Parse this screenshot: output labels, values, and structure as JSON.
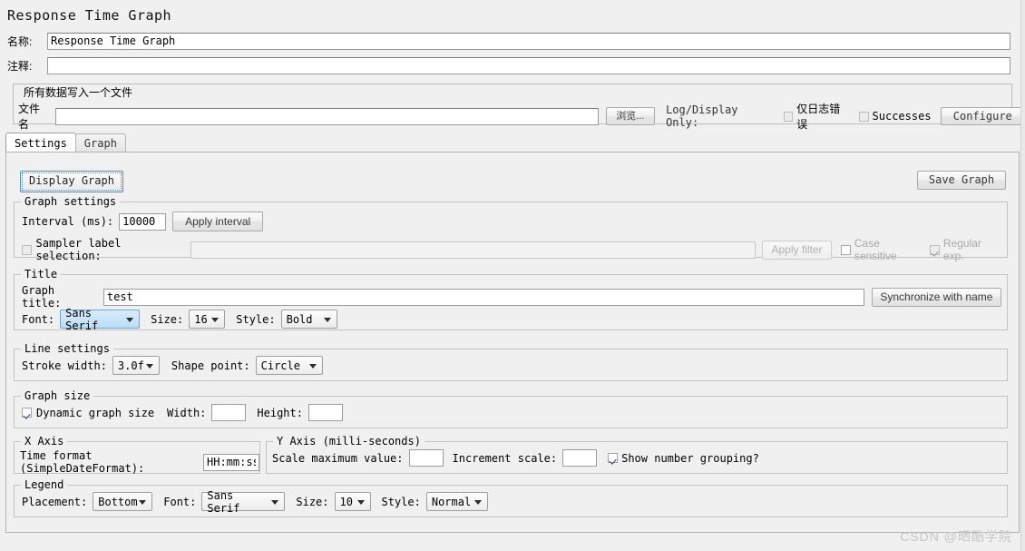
{
  "header": {
    "page_title": "Response Time Graph",
    "name_label": "名称:",
    "name_value": "Response Time Graph",
    "comment_label": "注释:",
    "comment_value": ""
  },
  "file_panel": {
    "title": "所有数据写入一个文件",
    "filename_label": "文件名",
    "filename_value": "",
    "browse_label": "浏览...",
    "log_display_label": "Log/Display Only:",
    "errors_only_label": "仅日志错误",
    "errors_only_checked": false,
    "successes_label": "Successes",
    "successes_checked": false,
    "configure_label": "Configure"
  },
  "tabs": [
    {
      "label": "Settings",
      "active": true
    },
    {
      "label": "Graph",
      "active": false
    }
  ],
  "actions": {
    "display_graph_label": "Display Graph",
    "save_graph_label": "Save Graph"
  },
  "graph_settings": {
    "group_title": "Graph settings",
    "interval_label": "Interval (ms):",
    "interval_value": "10000",
    "apply_interval_label": "Apply interval",
    "sampler_label_selection_label": "Sampler label selection:",
    "sampler_label_selection_checked": false,
    "sampler_filter_value": "",
    "apply_filter_label": "Apply filter",
    "case_sensitive_label": "Case sensitive",
    "case_sensitive_checked": false,
    "regular_exp_label": "Regular exp.",
    "regular_exp_checked": true
  },
  "title_section": {
    "group_title": "Title",
    "graph_title_label": "Graph title:",
    "graph_title_value": "test",
    "synchronize_label": "Synchronize with name",
    "font_label": "Font:",
    "font_value": "Sans Serif",
    "size_label": "Size:",
    "size_value": "16",
    "style_label": "Style:",
    "style_value": "Bold"
  },
  "line_settings": {
    "group_title": "Line settings",
    "stroke_width_label": "Stroke width:",
    "stroke_width_value": "3.0f",
    "shape_point_label": "Shape point:",
    "shape_point_value": "Circle"
  },
  "graph_size": {
    "group_title": "Graph size",
    "dynamic_label": "Dynamic graph size",
    "dynamic_checked": true,
    "width_label": "Width:",
    "width_value": "",
    "height_label": "Height:",
    "height_value": ""
  },
  "x_axis": {
    "group_title": "X Axis",
    "time_format_label": "Time format (SimpleDateFormat):",
    "time_format_value": "HH:mm:ss"
  },
  "y_axis": {
    "group_title": "Y Axis (milli-seconds)",
    "scale_max_label": "Scale maximum value:",
    "scale_max_value": "",
    "increment_scale_label": "Increment scale:",
    "increment_scale_value": "",
    "number_grouping_label": "Show number grouping?",
    "number_grouping_checked": true
  },
  "legend": {
    "group_title": "Legend",
    "placement_label": "Placement:",
    "placement_value": "Bottom",
    "font_label": "Font:",
    "font_value": "Sans Serif",
    "size_label": "Size:",
    "size_value": "10",
    "style_label": "Style:",
    "style_value": "Normal"
  },
  "watermark": {
    "text": "CSDN @晒酷学院"
  }
}
